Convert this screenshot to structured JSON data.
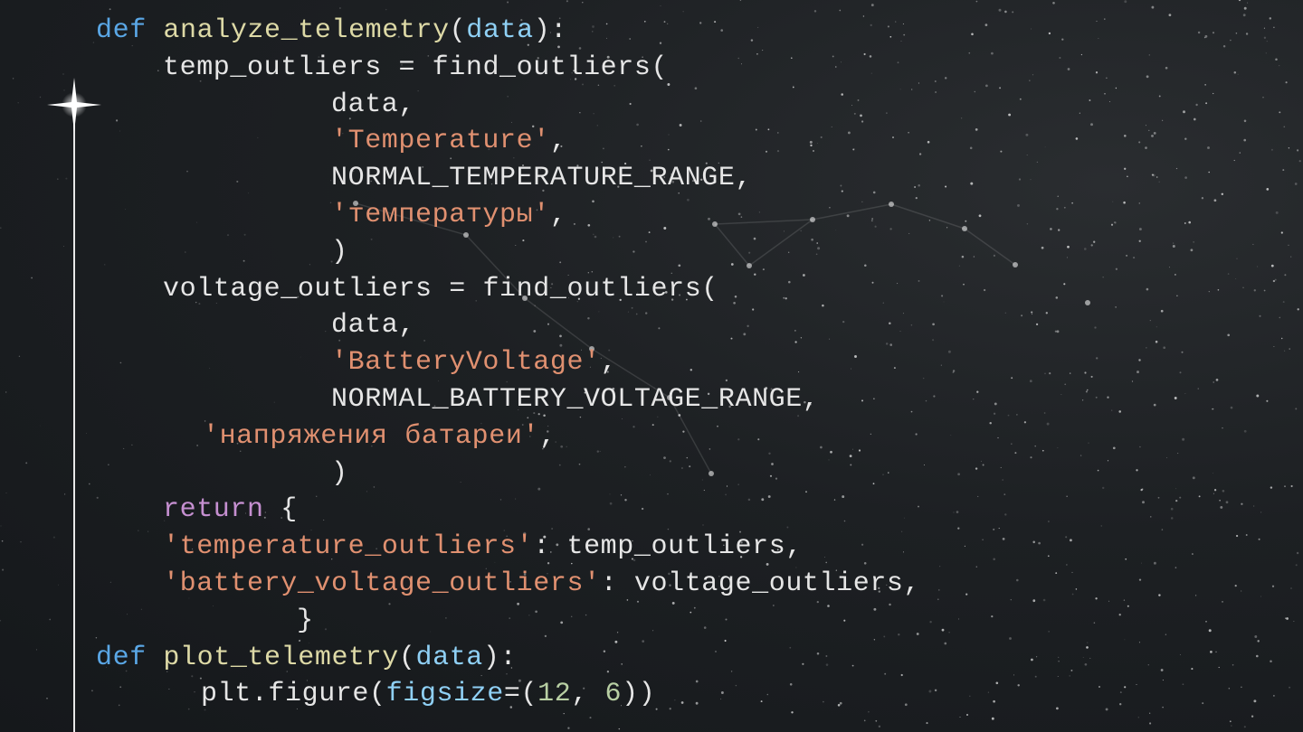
{
  "code_lines": [
    {
      "tokens": [
        {
          "t": "def",
          "c": "kw"
        },
        {
          "t": " ",
          "c": "plain"
        },
        {
          "t": "analyze_telemetry",
          "c": "fn"
        },
        {
          "t": "(",
          "c": "plain"
        },
        {
          "t": "data",
          "c": "param"
        },
        {
          "t": "):",
          "c": "plain"
        }
      ]
    },
    {
      "tokens": [
        {
          "t": "temp_outliers = find_outliers(",
          "c": "plain"
        }
      ]
    },
    {
      "tokens": [
        {
          "t": "data,",
          "c": "plain"
        }
      ]
    },
    {
      "tokens": [
        {
          "t": "'Temperature'",
          "c": "str"
        },
        {
          "t": ",",
          "c": "plain"
        }
      ]
    },
    {
      "tokens": [
        {
          "t": "NORMAL_TEMPERATURE_RANGE,",
          "c": "plain"
        }
      ]
    },
    {
      "tokens": [
        {
          "t": "'температуры'",
          "c": "str"
        },
        {
          "t": ",",
          "c": "plain"
        }
      ]
    },
    {
      "tokens": [
        {
          "t": ")",
          "c": "plain"
        }
      ]
    },
    {
      "tokens": [
        {
          "t": "voltage_outliers = find_outliers(",
          "c": "plain"
        }
      ]
    },
    {
      "tokens": [
        {
          "t": "data,",
          "c": "plain"
        }
      ]
    },
    {
      "tokens": [
        {
          "t": "'BatteryVoltage'",
          "c": "str"
        },
        {
          "t": ",",
          "c": "plain"
        }
      ]
    },
    {
      "tokens": [
        {
          "t": "NORMAL_BATTERY_VOLTAGE_RANGE,",
          "c": "plain"
        }
      ]
    },
    {
      "tokens": [
        {
          "t": "'напряжения батареи'",
          "c": "str"
        },
        {
          "t": ",",
          "c": "plain"
        }
      ]
    },
    {
      "tokens": [
        {
          "t": ")",
          "c": "plain"
        }
      ]
    },
    {
      "tokens": [
        {
          "t": "return",
          "c": "ret"
        },
        {
          "t": " {",
          "c": "plain"
        }
      ]
    },
    {
      "tokens": [
        {
          "t": "'temperature_outliers'",
          "c": "str"
        },
        {
          "t": ": temp_outliers,",
          "c": "plain"
        }
      ]
    },
    {
      "tokens": [
        {
          "t": "'battery_voltage_outliers'",
          "c": "str"
        },
        {
          "t": ": voltage_outliers,",
          "c": "plain"
        }
      ]
    },
    {
      "tokens": [
        {
          "t": "}",
          "c": "plain"
        }
      ]
    },
    {
      "tokens": [
        {
          "t": "def",
          "c": "kw"
        },
        {
          "t": " ",
          "c": "plain"
        },
        {
          "t": "plot_telemetry",
          "c": "fn"
        },
        {
          "t": "(",
          "c": "plain"
        },
        {
          "t": "data",
          "c": "param"
        },
        {
          "t": "):",
          "c": "plain"
        }
      ]
    },
    {
      "tokens": [
        {
          "t": "plt.figure(",
          "c": "plain"
        },
        {
          "t": "figsize",
          "c": "param"
        },
        {
          "t": "=(",
          "c": "plain"
        },
        {
          "t": "12",
          "c": "num"
        },
        {
          "t": ", ",
          "c": "plain"
        },
        {
          "t": "6",
          "c": "num"
        },
        {
          "t": "))",
          "c": "plain"
        }
      ]
    }
  ],
  "colors": {
    "keyword": "#5aa7e6",
    "function": "#ddd9a6",
    "parameter": "#8fd0f5",
    "string": "#e09070",
    "return": "#c58fd0",
    "number": "#b8cfa3",
    "text": "#e6e6e6",
    "timeline": "#e8e8e8"
  },
  "decorations": {
    "timeline_marker_icon": "four-point-sparkle-icon",
    "background": "starfield-with-constellation"
  }
}
